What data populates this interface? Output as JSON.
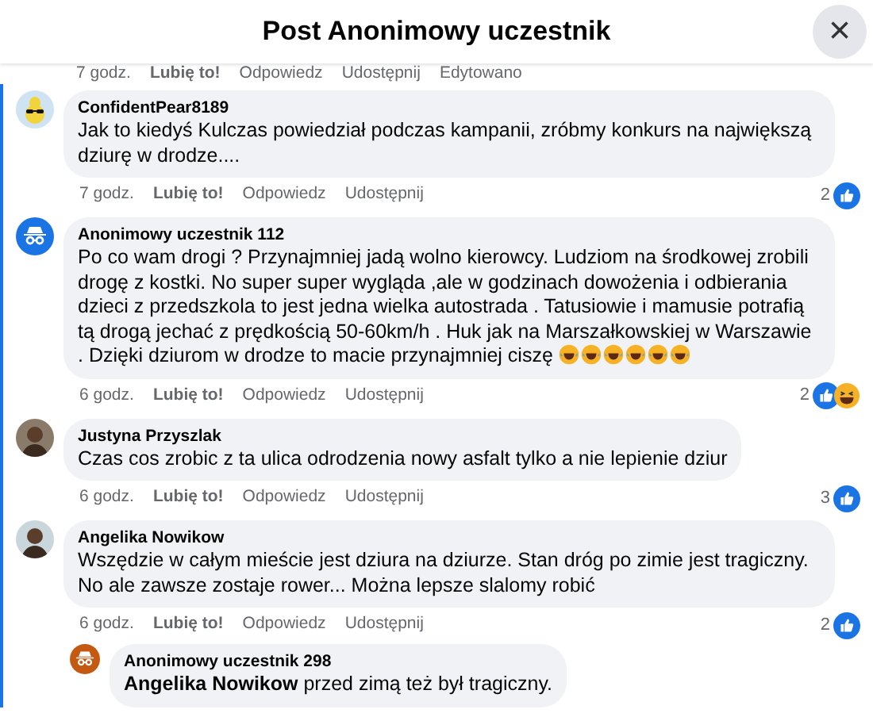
{
  "header": {
    "title": "Post Anonimowy uczestnik",
    "close": "×"
  },
  "top_actions": {
    "time": "7 godz.",
    "like": "Lubię to!",
    "reply": "Odpowiedz",
    "share": "Udostępnij",
    "edited": "Edytowano"
  },
  "comments": [
    {
      "author": "ConfidentPear8189",
      "avatar": {
        "kind": "cartoon",
        "color": "#f1d43c"
      },
      "text": "Jak to kiedyś Kulczas powiedział podczas kampanii, zróbmy konkurs na największą dziurę w drodze....",
      "time": "7 godz.",
      "like": "Lubię to!",
      "reply": "Odpowiedz",
      "share": "Udostępnij",
      "reactions": {
        "count": "2",
        "kinds": [
          {
            "kind": "like"
          }
        ]
      },
      "highlighted": true
    },
    {
      "author": "Anonimowy uczestnik 112",
      "avatar": {
        "kind": "anonymous",
        "color": "#1b74e4"
      },
      "text": "Po co wam drogi ? Przynajmniej jadą wolno kierowcy. Ludziom na środkowej zrobili drogę z kostki. No super super wygląda ,ale w godzinach dowożenia i odbierania dzieci z przedszkola to jest jedna wielka autostrada . Tatusiowie i mamusie potrafią tą drogą jechać z prędkością 50-60km/h . Huk jak na Marszałkowskiej w Warszawie . Dzięki dziurom w drodze to macie przynajmniej ciszę",
      "emoji": [
        {
          "kind": "haha"
        },
        {
          "kind": "haha"
        },
        {
          "kind": "haha"
        },
        {
          "kind": "haha"
        },
        {
          "kind": "haha"
        },
        {
          "kind": "haha"
        }
      ],
      "time": "6 godz.",
      "like": "Lubię to!",
      "reply": "Odpowiedz",
      "share": "Udostępnij",
      "reactions": {
        "count": "2",
        "kinds": [
          {
            "kind": "like"
          },
          {
            "kind": "haha"
          }
        ]
      },
      "highlighted": true
    },
    {
      "author": "Justyna Przyszlak",
      "avatar": {
        "kind": "picture",
        "color": "#8a7a6a"
      },
      "text": "Czas cos zrobic z ta ulica odrodzenia nowy asfalt tylko a nie lepienie dziur",
      "time": "6 godz.",
      "like": "Lubię to!",
      "reply": "Odpowiedz",
      "share": "Udostępnij",
      "reactions": {
        "count": "3",
        "kinds": [
          {
            "kind": "like"
          }
        ]
      },
      "highlighted": true
    },
    {
      "author": "Angelika Nowikow",
      "avatar": {
        "kind": "picture",
        "color": "#c9d6dc"
      },
      "text": "Wszędzie w całym mieście jest dziura na dziurze. Stan dróg po zimie jest tragiczny. No ale zawsze zostaje rower... Można lepsze slalomy robić",
      "time": "6 godz.",
      "like": "Lubię to!",
      "reply": "Odpowiedz",
      "share": "Udostępnij",
      "reactions": {
        "count": "2",
        "kinds": [
          {
            "kind": "like"
          }
        ]
      },
      "highlighted": true,
      "replies": [
        {
          "author": "Anonimowy uczestnik 298",
          "avatar": {
            "kind": "anonymous",
            "color": "#c45a12"
          },
          "text": "**Angelika Nowikow** przed zimą też był tragiczny."
        }
      ]
    }
  ]
}
